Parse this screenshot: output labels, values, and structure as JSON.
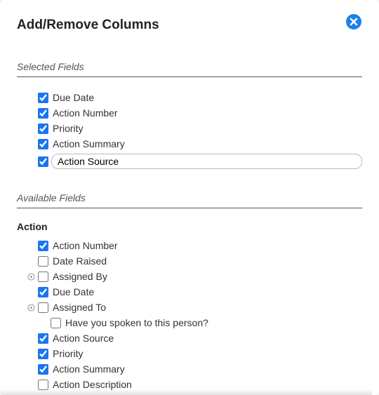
{
  "dialog": {
    "title": "Add/Remove Columns",
    "close_icon": "close"
  },
  "selected": {
    "heading": "Selected Fields",
    "items": [
      {
        "label": "Due Date",
        "checked": true,
        "editing": false
      },
      {
        "label": "Action Number",
        "checked": true,
        "editing": false
      },
      {
        "label": "Priority",
        "checked": true,
        "editing": false
      },
      {
        "label": "Action Summary",
        "checked": true,
        "editing": false
      },
      {
        "label": "Action Source",
        "checked": true,
        "editing": true
      }
    ]
  },
  "available": {
    "heading": "Available Fields",
    "groups": [
      {
        "name": "Action",
        "items": [
          {
            "label": "Action Number",
            "checked": true,
            "expandable": false,
            "child": false
          },
          {
            "label": "Date Raised",
            "checked": false,
            "expandable": false,
            "child": false
          },
          {
            "label": "Assigned By",
            "checked": false,
            "expandable": true,
            "child": false
          },
          {
            "label": "Due Date",
            "checked": true,
            "expandable": false,
            "child": false
          },
          {
            "label": "Assigned To",
            "checked": false,
            "expandable": true,
            "child": false
          },
          {
            "label": "Have you spoken to this person?",
            "checked": false,
            "expandable": false,
            "child": true
          },
          {
            "label": "Action Source",
            "checked": true,
            "expandable": false,
            "child": false
          },
          {
            "label": "Priority",
            "checked": true,
            "expandable": false,
            "child": false
          },
          {
            "label": "Action Summary",
            "checked": true,
            "expandable": false,
            "child": false
          },
          {
            "label": "Action Description",
            "checked": false,
            "expandable": false,
            "child": false
          }
        ]
      }
    ]
  }
}
